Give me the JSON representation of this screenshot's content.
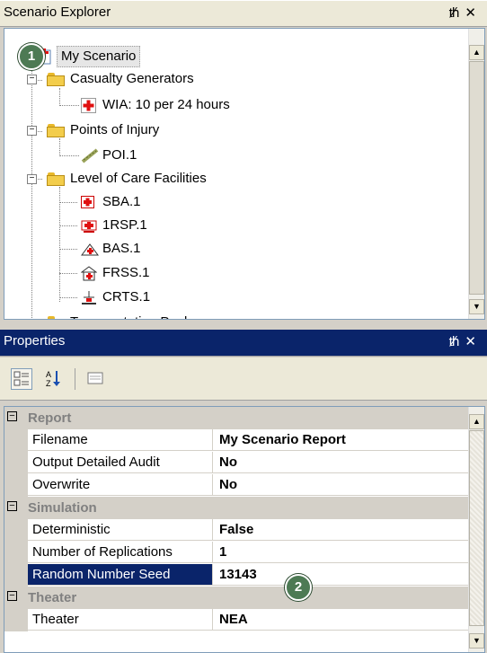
{
  "explorer": {
    "title": "Scenario Explorer",
    "pin_icon": "pin-icon",
    "close_icon": "close-icon",
    "root": "My Scenario",
    "nodes": [
      {
        "label": "Casualty Generators",
        "icon": "folder-icon"
      },
      {
        "label": "WIA: 10 per 24 hours",
        "icon": "red-cross-icon"
      },
      {
        "label": "Points of Injury",
        "icon": "folder-icon"
      },
      {
        "label": "POI.1",
        "icon": "stretcher-icon"
      },
      {
        "label": "Level of Care Facilities",
        "icon": "folder-icon"
      },
      {
        "label": "SBA.1",
        "icon": "medical-box-icon"
      },
      {
        "label": "1RSP.1",
        "icon": "medic-icon"
      },
      {
        "label": "BAS.1",
        "icon": "tent-icon"
      },
      {
        "label": "FRSS.1",
        "icon": "hospital-icon"
      },
      {
        "label": "CRTS.1",
        "icon": "facility-icon"
      }
    ],
    "partial_node": "Transportation Pools"
  },
  "properties": {
    "title": "Properties",
    "toolbar": {
      "categorized_icon": "categorized-icon",
      "alphabetical_icon": "alphabetical-icon",
      "pages_icon": "property-pages-icon"
    },
    "categories": [
      {
        "label": "Report",
        "rows": [
          {
            "name": "Filename",
            "value": "My Scenario Report"
          },
          {
            "name": "Output Detailed Audit",
            "value": "No"
          },
          {
            "name": "Overwrite",
            "value": "No"
          }
        ]
      },
      {
        "label": "Simulation",
        "rows": [
          {
            "name": "Deterministic",
            "value": "False"
          },
          {
            "name": "Number of Replications",
            "value": "1"
          },
          {
            "name": "Random Number Seed",
            "value": "13143"
          }
        ]
      },
      {
        "label": "Theater",
        "rows": [
          {
            "name": "Theater",
            "value": "NEA"
          }
        ]
      }
    ]
  },
  "callouts": [
    "1",
    "2"
  ],
  "colors": {
    "selection": "#0a246a",
    "panel": "#d4d0c8",
    "callout": "#4d7a54"
  }
}
